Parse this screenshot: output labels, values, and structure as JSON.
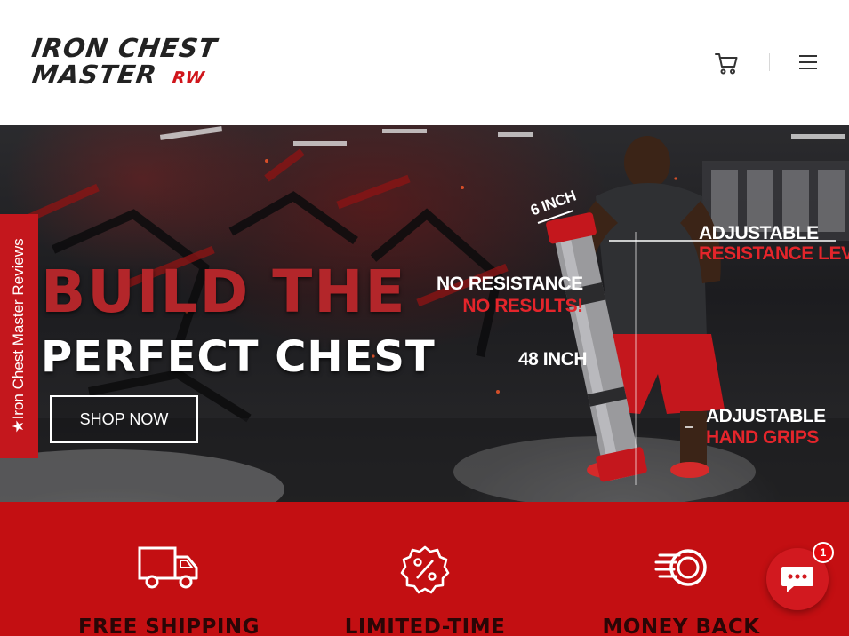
{
  "header": {
    "logo_line_1": "IRON CHEST",
    "logo_line_2": "MASTER",
    "logo_mark": "RW",
    "cart_icon": "cart-icon",
    "menu_icon": "hamburger-menu-icon"
  },
  "hero": {
    "headline_1": "BUILD THE",
    "headline_2": "PERFECT CHEST",
    "cta_label": "SHOP NOW",
    "callouts": {
      "six_inch": "6 INCH",
      "no_resistance_1": "NO RESISTANCE",
      "no_resistance_2": "NO RESULTS!",
      "adjustable_1": "ADJUSTABLE",
      "resistance_levels": "RESISTANCE LEVELS",
      "forty_eight_inch": "48 INCH",
      "adjustable_2": "ADJUSTABLE",
      "hand_grips": "HAND GRIPS"
    }
  },
  "reviews_tab": {
    "label": "★Iron Chest Master Reviews"
  },
  "features": [
    {
      "title": "FREE SHIPPING",
      "icon": "delivery-truck-icon"
    },
    {
      "title": "LIMITED-TIME",
      "icon": "percent-badge-icon"
    },
    {
      "title": "MONEY BACK",
      "icon": "coin-stack-icon"
    }
  ],
  "chat": {
    "icon": "chat-bubble-icon",
    "badge_count": "1"
  },
  "colors": {
    "brand_red": "#c30f12",
    "headline_red": "#b3262a",
    "header_bg": "#ffffff"
  }
}
